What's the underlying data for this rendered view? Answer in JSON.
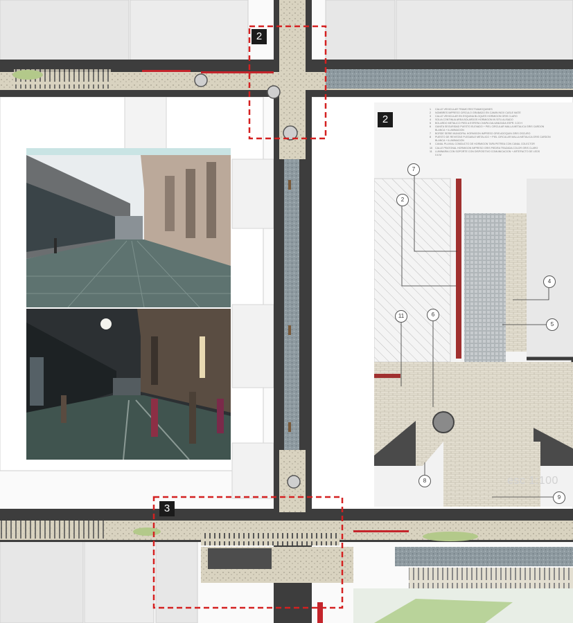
{
  "callouts": {
    "top_detail": "2",
    "bottom_detail": "3",
    "panel_badge": "2"
  },
  "detail_panel": {
    "scale": "esc 1:100",
    "markers": [
      "7",
      "2",
      "4",
      "5",
      "11",
      "6",
      "8",
      "9"
    ]
  },
  "legend": [
    {
      "num": "1",
      "text": "CALLE VEHICULAR TRAMO RECTIVAMOQUINES"
    },
    {
      "num": "2",
      "text": "NOMBRES IMPRESO CIRCULO GRABADO EN CAMIN INOX CASLE MATE"
    },
    {
      "num": "3",
      "text": "CALLE VEHICULAR EN ESQUINA BLOQUES HORMIGON GRIS CLARO"
    },
    {
      "num": "4",
      "text": "SOLIA CONTINUA AREA BOLARDOS HORMIGON IN SITU ALISADO"
    },
    {
      "num": "5",
      "text": "BOLARDO METALICO PIED A ESFERA CHAPA GALVANIZADA ESPR. 0.20 H"
    },
    {
      "num": "6",
      "text": "GANITA SEGURIDAD PUESTO ELEVADO + PIEL CIRCULAR MALLA METALICA GRIS CARDON"
    },
    {
      "num": "",
      "text": "BLANCA + ILUMINACION"
    },
    {
      "num": "7",
      "text": "BORDE SERIE MUNICIPAL HORMIGON IMPRESO GRIS ADOQUIN GRIS OSCURO"
    },
    {
      "num": "8",
      "text": "PUESTO DE REVISTAS PLEGABLE METALICO + PIEL CIRCULAR MALLA METALICA GRIS CARDON"
    },
    {
      "num": "",
      "text": "BLANCA + ILUMINACION"
    },
    {
      "num": "9",
      "text": "CANAL PLUVIAL CONDUCTO DE HORMIGON TAPA PETREA CON CANAL COLECTOR"
    },
    {
      "num": "10",
      "text": "CALLE PEATONAL HORMIGON IMPRESO GRIS PIEDRA TRAZADA COLOR GRIS CLARO"
    },
    {
      "num": "11",
      "text": "LUMINARIA CON SOPORTE CON DISPOSITIVO COMUNICACION + ARTEFACTO DE LEDS"
    },
    {
      "num": "",
      "text": "0.6 M"
    }
  ],
  "colors": {
    "road": "#3d3d3d",
    "paving": "#d9d3c0",
    "sidewalk_gray": "#9aa0a4",
    "building": "#e7e7e7",
    "accent_red": "#c4242b",
    "greenery": "#8fb060",
    "photo_strip": "#c9e4e4"
  }
}
